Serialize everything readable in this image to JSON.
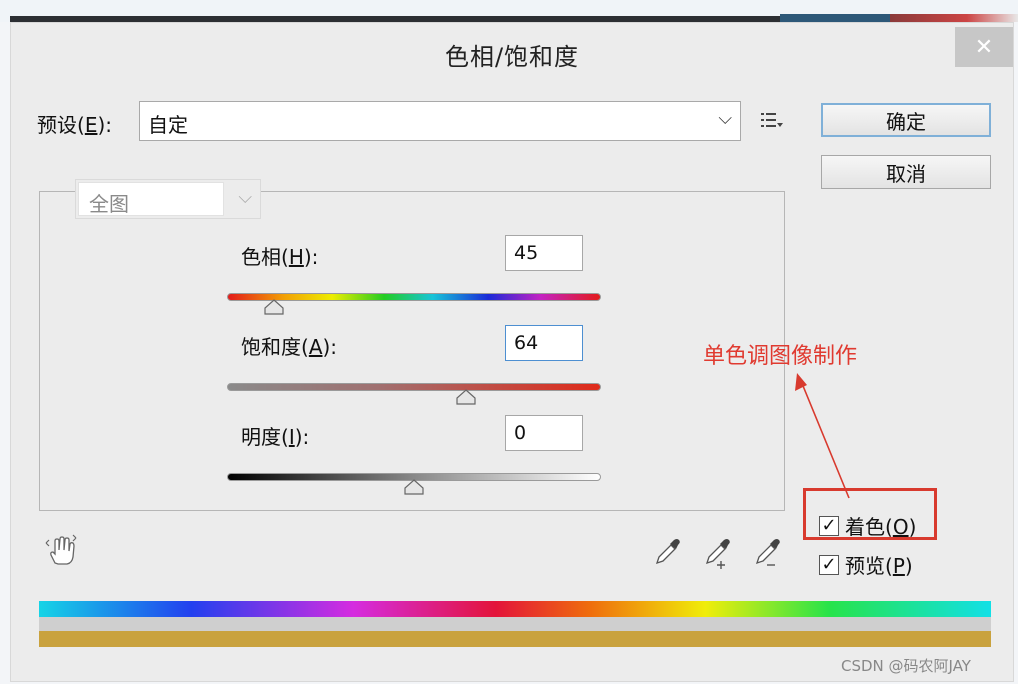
{
  "dialog": {
    "title": "色相/饱和度",
    "close_label": "✕"
  },
  "preset": {
    "label_prefix": "预设(",
    "label_key": "E",
    "label_suffix": "):",
    "value": "自定",
    "menu_icon": "preset-options-icon"
  },
  "buttons": {
    "ok": "确定",
    "cancel": "取消"
  },
  "channel": {
    "value": "全图"
  },
  "sliders": {
    "hue": {
      "label_prefix": "色相(",
      "key": "H",
      "label_suffix": "):",
      "value": "45",
      "level": 0.125
    },
    "saturation": {
      "label_prefix": "饱和度(",
      "key": "A",
      "label_suffix": "):",
      "value": "64",
      "level": 0.64
    },
    "lightness": {
      "label_prefix": "明度(",
      "key": "I",
      "label_suffix": "):",
      "value": "0",
      "level": 0.5
    }
  },
  "options": {
    "colorize": {
      "label_prefix": "着色(",
      "key": "O",
      "label_suffix": ")",
      "checked": true
    },
    "preview": {
      "label_prefix": "预览(",
      "key": "P",
      "label_suffix": ")",
      "checked": true
    }
  },
  "annotation": {
    "text": "单色调图像制作",
    "color": "#e03a30"
  },
  "watermark": "CSDN @码农阿JAY",
  "colors": {
    "accent_focus": "#4d8fd1",
    "highlight_box": "#d83a2e",
    "colorize_strip": "#c9a23e"
  }
}
